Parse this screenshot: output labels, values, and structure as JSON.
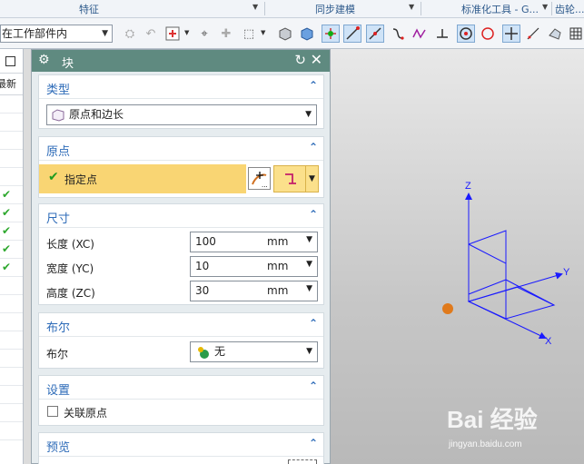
{
  "ribbon": {
    "groups": [
      "特征",
      "同步建模",
      "标准化工具 - G...",
      "齿轮..."
    ]
  },
  "toolbar": {
    "scope_select": "在工作部件内",
    "icons": [
      "select-filter-icon",
      "snap-icon",
      "point-snap-icon",
      "selection-icon",
      "box-select-icon",
      "view-icon",
      "shade-icon",
      "existing-point-icon",
      "endpoint-icon",
      "midpoint-icon",
      "curve-icon",
      "spline-icon",
      "quadrant-icon",
      "arc-center-icon",
      "intersection-icon",
      "point-on-curve-icon",
      "grid-icon"
    ]
  },
  "navigator": {
    "new_label": "最新",
    "check_rows": [
      5,
      6,
      7,
      8,
      9
    ]
  },
  "dialog": {
    "title": "块",
    "type_section": {
      "label": "类型",
      "value": "原点和边长"
    },
    "origin_section": {
      "label": "原点",
      "specify_point": "指定点"
    },
    "dimensions_section": {
      "label": "尺寸",
      "fields": [
        {
          "label": "长度 (XC)",
          "value": "100",
          "unit": "mm"
        },
        {
          "label": "宽度 (YC)",
          "value": "10",
          "unit": "mm"
        },
        {
          "label": "高度 (ZC)",
          "value": "30",
          "unit": "mm"
        }
      ]
    },
    "boolean_section": {
      "label": "布尔",
      "field_label": "布尔",
      "value": "无"
    },
    "settings_section": {
      "label": "设置",
      "checkbox_label": "关联原点",
      "checked": false
    },
    "preview_section": {
      "label": "预览"
    }
  },
  "viewport": {
    "axes": {
      "x": "X",
      "y": "Y",
      "z": "Z"
    },
    "axis_color": "#1a1aff",
    "origin_color": "#e07a1c"
  },
  "watermark": {
    "text": "Bai 经验",
    "url_text": "jingyan.baidu.com"
  }
}
